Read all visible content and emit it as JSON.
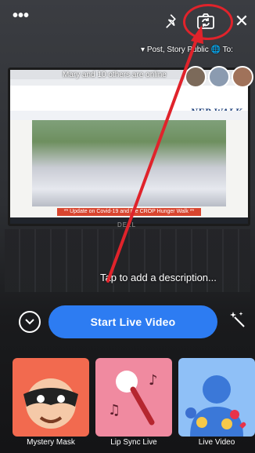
{
  "top_bar": {
    "more_label": "•••",
    "flip_camera_icon": "camera-flip-icon",
    "pin_icon": "pin-icon",
    "close_label": "✕"
  },
  "audience": {
    "to_label": "To:",
    "audience_value": "Public",
    "post_type": "Post, Story",
    "dropdown_glyph": "▾"
  },
  "viewers": {
    "text": "Mary and 10 others are online"
  },
  "laptop": {
    "logo": "NER WALK",
    "banner": "** Update on Covid-19 and the CROP Hunger Walk **",
    "brand": "DELL"
  },
  "description_prompt": "Tap to add a description...",
  "start_button": "Start Live Video",
  "effects": [
    {
      "label": "Mystery Mask"
    },
    {
      "label": "Lip Sync Live"
    },
    {
      "label": "Live Video"
    }
  ],
  "colors": {
    "accent": "#2d7cf2",
    "highlight": "#e0232b"
  }
}
